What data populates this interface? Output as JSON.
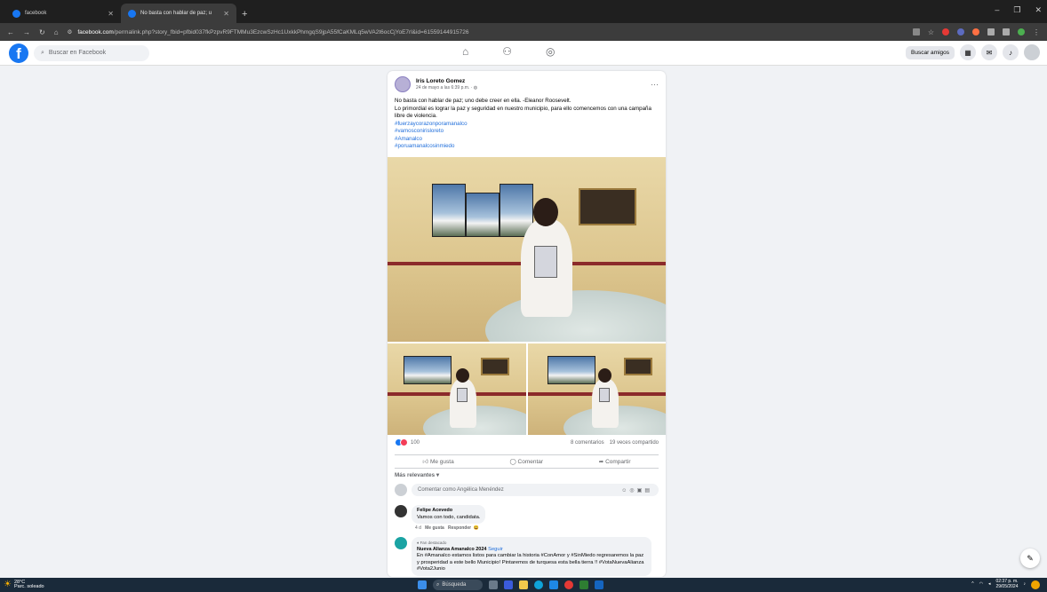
{
  "browser": {
    "tabs": [
      {
        "title": "facebook",
        "active": false
      },
      {
        "title": "No basta con hablar de paz; u",
        "active": true
      }
    ],
    "url_host": "facebook.com",
    "url_path": "/permalink.php?story_fbid=pfbid037fkPzpvR9FTMMu3EzcwSzHc1UxkkPhmgqS9jpA55fCaKMLq5wVA2t6ocCjYoE7rl&id=61559144915726"
  },
  "facebook": {
    "search_placeholder": "Buscar en Facebook",
    "find_friends": "Buscar amigos"
  },
  "post": {
    "author": "Iris Loreto Gomez",
    "meta": "24 de mayo a las 6:39 p.m. · ",
    "text_lines": [
      "No basta con hablar de paz; uno debe creer en ella. -Eleanor Roosevelt.",
      "Lo primordial es lograr la paz y seguridad en nuestro municipio, para ello comencemos con una campaña libre de violencia."
    ],
    "hashtags": [
      "#fuerzaycorazonporamanalco",
      "#vamosconirisloreto",
      "#Amanalco",
      "#poruamanalcosinmiedo"
    ],
    "reaction_count": "100",
    "comments_count": "8 comentarios",
    "shares_count": "19 veces compartido",
    "actions": {
      "like": "Me gusta",
      "comment": "Comentar",
      "share": "Compartir"
    },
    "sort_label": "Más relevantes",
    "comment_placeholder": "Comentar como Angélica Menéndez"
  },
  "comments": [
    {
      "author": "Felipe Acevedo",
      "text": "Vamos con todo, candidata.",
      "time": "4 d",
      "like": "Me gusta",
      "reply": "Responder"
    },
    {
      "badge": "Fan destacado",
      "author": "Nueva Alianza Amanalco 2024",
      "follow": "Seguir",
      "text": "En #Amanalco estamos listos para cambiar la historia #ConAmor y #SinMiedo regresaremos la paz y prosperidad a este bello Municipio! Pintaremos de turquesa esta bella tierra !! #VotaNuevaAlianza #Vota2Junio"
    }
  ],
  "taskbar": {
    "temp": "28°C",
    "weather": "Parc. soleado",
    "search": "Búsqueda",
    "time": "02:37 p. m.",
    "date": "29/05/2024"
  },
  "colors": {
    "fb_blue": "#1877f2",
    "link": "#216fdb"
  }
}
